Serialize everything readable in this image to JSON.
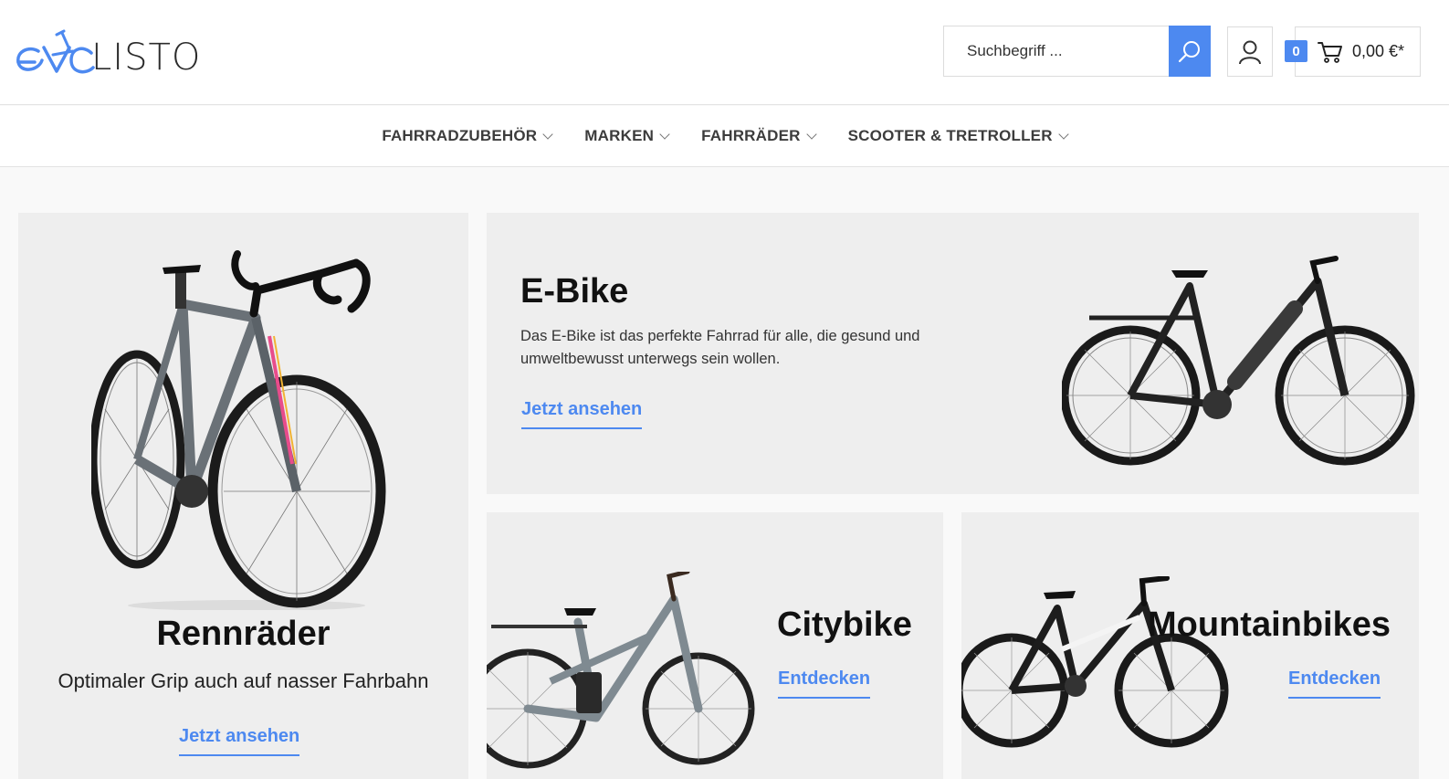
{
  "header": {
    "logo_text": "LISTO",
    "search": {
      "placeholder": "Suchbegriff ..."
    },
    "cart": {
      "count": "0",
      "total": "0,00 €*"
    }
  },
  "nav": {
    "items": [
      {
        "label": "FAHRRADZUBEHÖR"
      },
      {
        "label": "MARKEN"
      },
      {
        "label": "FAHRRÄDER"
      },
      {
        "label": "SCOOTER & TRETROLLER"
      }
    ]
  },
  "tiles": {
    "rennraeder": {
      "title": "Rennräder",
      "text": "Optimaler Grip auch auf nasser Fahrbahn",
      "link": "Jetzt ansehen"
    },
    "ebike": {
      "title": "E-Bike",
      "text": "Das E-Bike ist das perfekte Fahrrad für alle, die gesund und umweltbewusst unterwegs sein wollen.",
      "link": "Jetzt ansehen"
    },
    "citybike": {
      "title": "Citybike",
      "link": "Entdecken"
    },
    "mountainbikes": {
      "title": "Mountainbikes",
      "link": "Entdecken"
    }
  },
  "colors": {
    "accent": "#4d89f0",
    "tile_bg": "#eeeeee",
    "page_bg": "#f9f9f9"
  }
}
